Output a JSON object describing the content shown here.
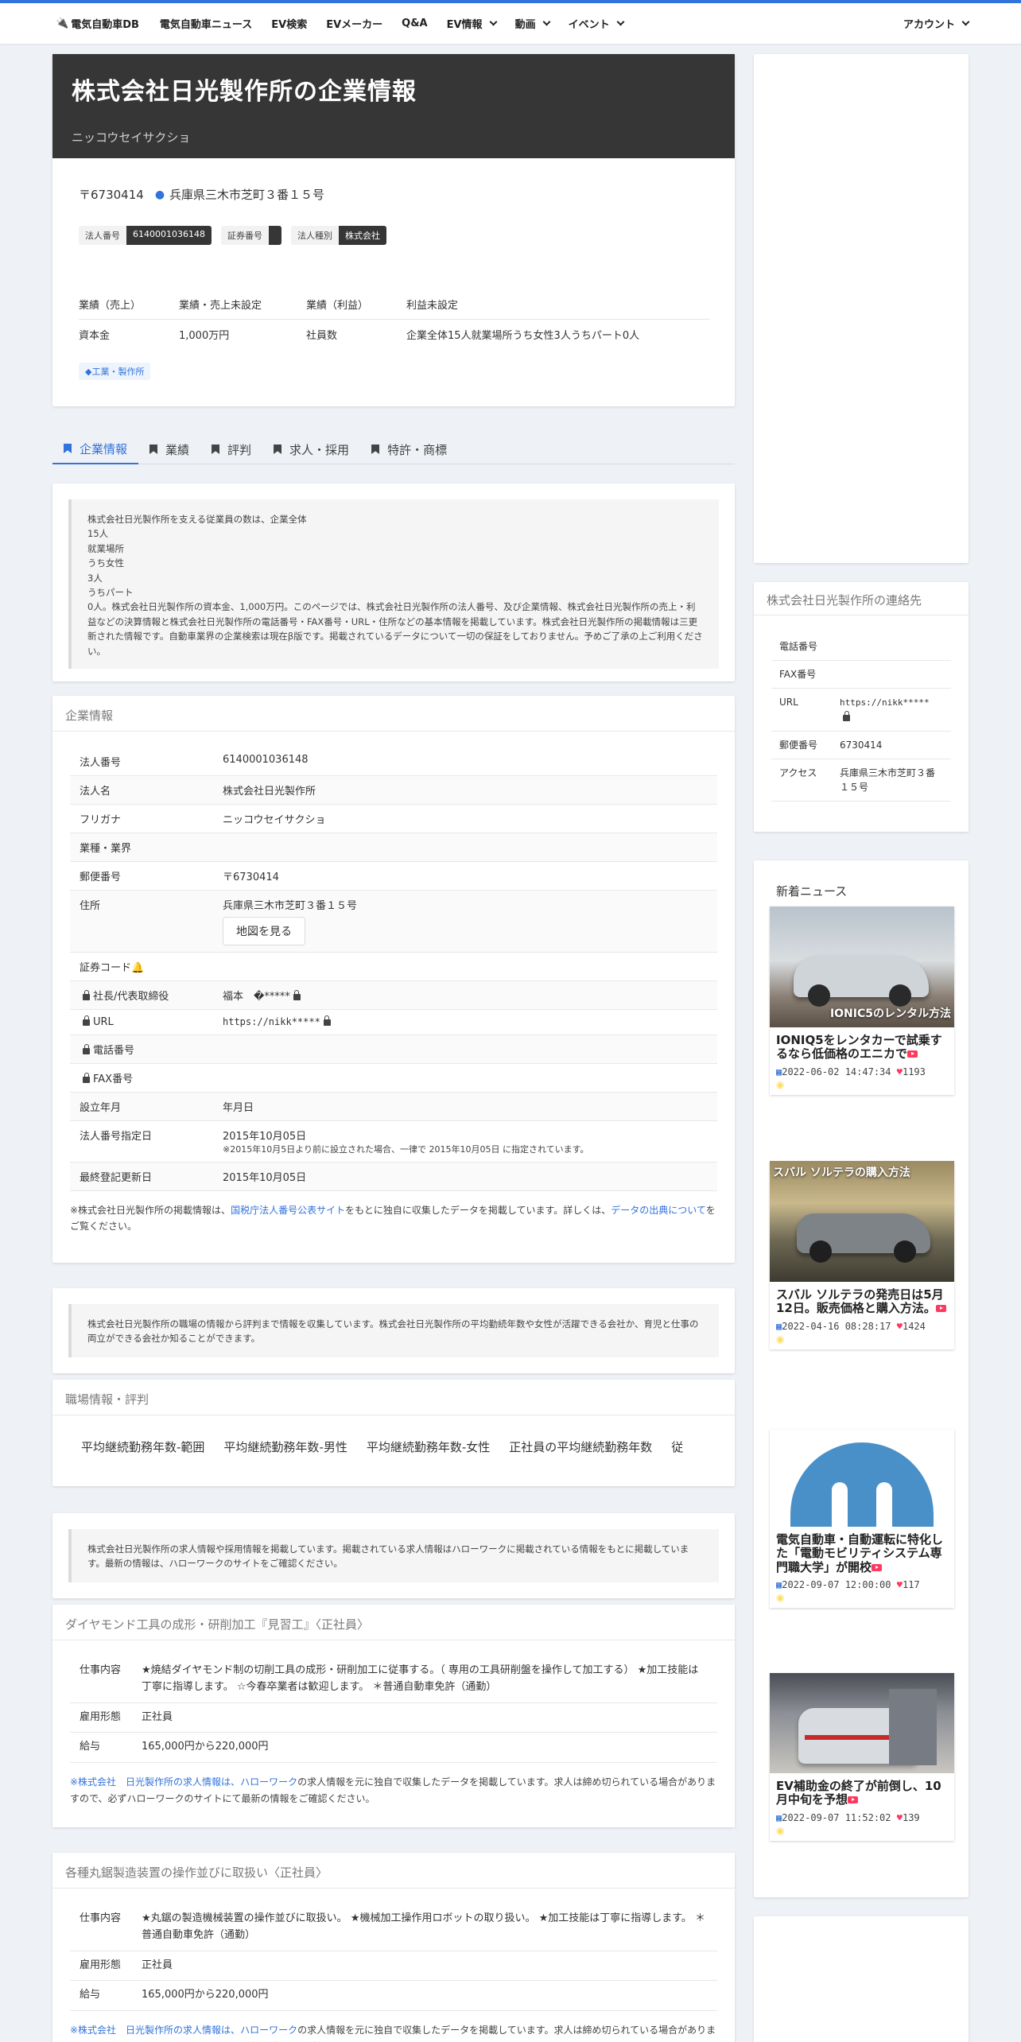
{
  "nav": {
    "brand": "電気自動車DB",
    "items": [
      "電気自動車ニュース",
      "EV検索",
      "EVメーカー",
      "Q&A",
      "EV情報",
      "動画",
      "イベント"
    ],
    "account": "アカウント"
  },
  "company": {
    "title": "株式会社日光製作所の企業情報",
    "kana": "ニッコウセイサクショ",
    "postal": "〒6730414",
    "address": "兵庫県三木市芝町３番１５号",
    "tags": {
      "corp_no_label": "法人番号",
      "corp_no": "6140001036148",
      "sec_label": "証券番号",
      "sec_value": "",
      "type_label": "法人種別",
      "type_value": "株式会社"
    },
    "perf": {
      "sales_label": "業績（売上）",
      "sales_value": "業績・売上未設定",
      "profit_label": "業績（利益）",
      "profit_value": "利益未設定",
      "capital_label": "資本金",
      "capital_value": "1,000万円",
      "employees_label": "社員数",
      "employees_value": "企業全体15人就業場所うち女性3人うちパート0人"
    },
    "category": "工業・製作所"
  },
  "tabs": [
    "企業情報",
    "業績",
    "評判",
    "求人・採用",
    "特許・商標"
  ],
  "description": {
    "lines": [
      "株式会社日光製作所を支える従業員の数は、企業全体",
      "15人",
      "就業場所",
      "うち女性",
      "3人",
      "うちパート",
      "0人。株式会社日光製作所の資本金、1,000万円。このページでは、株式会社日光製作所の法人番号、及び企業情報、株式会社日光製作所の売上・利益などの決算情報と株式会社日光製作所の電話番号・FAX番号・URL・住所などの基本情報を掲載しています。株式会社日光製作所の掲載情報は三更新された情報です。自動車業界の企業検索は現在β版です。掲載されているデータについて一切の保証をしておりません。予めご了承の上ご利用ください。"
    ]
  },
  "info": {
    "title": "企業情報",
    "rows": {
      "corp_no": [
        "法人番号",
        "6140001036148"
      ],
      "name": [
        "法人名",
        "株式会社日光製作所"
      ],
      "kana": [
        "フリガナ",
        "ニッコウセイサクショ"
      ],
      "industry": [
        "業種・業界",
        ""
      ],
      "postal": [
        "郵便番号",
        "〒6730414"
      ],
      "address": [
        "住所",
        "兵庫県三木市芝町３番１５号"
      ],
      "sec_code": [
        "証券コード",
        ""
      ],
      "ceo": [
        "社長/代表取締役",
        "福本　�*****"
      ],
      "url": [
        "URL",
        "https://nikk*****"
      ],
      "tel": [
        "電話番号",
        ""
      ],
      "fax": [
        "FAX番号",
        ""
      ],
      "founded": [
        "設立年月",
        "年月日"
      ],
      "designated": [
        "法人番号指定日",
        "2015年10月05日"
      ],
      "updated": [
        "最終登記更新日",
        "2015年10月05日"
      ]
    },
    "map_button": "地図を見る",
    "designated_note": "※2015年10月5日より前に設立された場合、一律で 2015年10月05日 に指定されています。",
    "note_pre": "※株式会社日光製作所の掲載情報は、",
    "note_link1": "国税庁法人番号公表サイト",
    "note_mid": "をもとに独自に収集したデータを掲載しています。詳しくは、",
    "note_link2": "データの出典について",
    "note_post": "をご覧ください。"
  },
  "workplace": {
    "quote": "株式会社日光製作所の職場の情報から評判まで情報を収集しています。株式会社日光製作所の平均勤続年数や女性が活躍できる会社か、育児と仕事の両立ができる会社か知ることができます。",
    "title": "職場情報・評判",
    "items": [
      "平均継続勤務年数-範囲",
      "平均継続勤務年数-男性",
      "平均継続勤務年数-女性",
      "正社員の平均継続勤務年数",
      "従"
    ]
  },
  "jobs": {
    "quote": "株式会社日光製作所の求人情報や採用情報を掲載しています。掲載されている求人情報はハローワークに掲載されている情報をもとに掲載しています。最新の情報は、ハローワークのサイトをご確認ください。",
    "labels": {
      "content": "仕事内容",
      "type": "雇用形態",
      "salary": "給与"
    },
    "list": [
      {
        "title": "ダイヤモンド工具の成形・研削加工『見習工』〈正社員〉",
        "content": "★焼結ダイヤモンド制の切削工具の成形・研削加工に従事する。（ 専用の工具研削盤を操作して加工する） ★加工技能は丁寧に指導します。 ☆今春卒業者は歓迎します。 ＊普通自動車免許（通勤）",
        "type": "正社員",
        "salary": "165,000円から220,000円"
      },
      {
        "title": "各種丸鋸製造装置の操作並びに取扱い〈正社員〉",
        "content": "★丸鋸の製造機械装置の操作並びに取扱い。 ★機械加工操作用ロボットの取り扱い。 ★加工技能は丁寧に指導します。 ＊普通自動車免許（通勤）",
        "type": "正社員",
        "salary": "165,000円から220,000円"
      }
    ],
    "note_pre": "※株式会社　日光製作所の求人情報は、",
    "note_link": "ハローワーク",
    "note_post": "の求人情報を元に独自で収集したデータを掲載しています。求人は締め切られている場合がありますので、必ずハローワークのサイトにて最新の情報をご確認ください。"
  },
  "contact": {
    "title": "株式会社日光製作所の連絡先",
    "rows": {
      "tel": [
        "電話番号",
        ""
      ],
      "fax": [
        "FAX番号",
        ""
      ],
      "url": [
        "URL",
        "https://nikk*****"
      ],
      "postal": [
        "郵便番号",
        "6730414"
      ],
      "access": [
        "アクセス",
        "兵庫県三木市芝町３番１５号"
      ]
    }
  },
  "news": {
    "heading": "新着ニュース",
    "items": [
      {
        "caption": "IONIC5のレンタル方法",
        "title": "IONIQ5をレンタカーで試乗するなら低価格のエニカで",
        "date": "2022-06-02 14:47:34",
        "likes": "1193"
      },
      {
        "caption": "スバル ソルテラの購入方法",
        "title": "スバル ソルテラの発売日は5月12日。販売価格と購入方法。",
        "date": "2022-04-16 08:28:17",
        "likes": "1424"
      },
      {
        "caption": "",
        "title": "電気自動車・自動運転に特化した「電動モビリティシステム専門職大学」が開校",
        "date": "2022-09-07 12:00:00",
        "likes": "117"
      },
      {
        "caption": "",
        "title": "EV補助金の終了が前倒し、10月中旬を予想",
        "date": "2022-09-07 11:52:02",
        "likes": "139"
      }
    ]
  },
  "colors": {
    "accent": "#3273dc",
    "hero": "#363636",
    "youtube": "#ff3860",
    "rss": "#ffdd57"
  }
}
